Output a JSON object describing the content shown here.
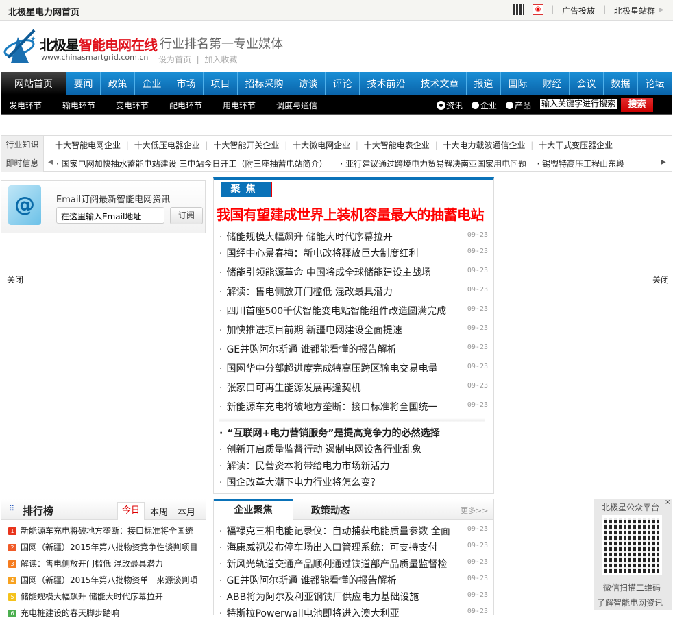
{
  "topbar": {
    "title": "北极星电力网首页",
    "ad": "广告投放",
    "sites": "北极星站群"
  },
  "logo": {
    "brand_black": "北极星",
    "brand_red": "智能电网在线",
    "url": "www.chinasmartgrid.com.cn",
    "slogan": "行业排名第一专业媒体",
    "set_home": "设为首页",
    "bookmark": "加入收藏"
  },
  "nav": {
    "main": [
      "网站首页",
      "要闻",
      "政策",
      "企业",
      "市场",
      "项目",
      "招标采购",
      "访谈",
      "评论",
      "技术前沿",
      "技术文章",
      "报道",
      "国际",
      "财经",
      "会议",
      "数据",
      "论坛"
    ],
    "sub": [
      "发电环节",
      "输电环节",
      "变电环节",
      "配电环节",
      "用电环节",
      "调度与通信"
    ]
  },
  "search": {
    "options": [
      "资讯",
      "企业",
      "产品"
    ],
    "selected": "资讯",
    "placeholder": "输入关键字进行搜索",
    "button": "搜索"
  },
  "knowledge": {
    "label": "行业知识",
    "links": [
      "十大智能电网企业",
      "十大低压电器企业",
      "十大智能开关企业",
      "十大微电网企业",
      "十大智能电表企业",
      "十大电力载波通信企业",
      "十大干式变压器企业"
    ]
  },
  "ticker": {
    "label": "即时信息",
    "items": [
      "国家电网加快抽水蓄能电站建设 三电站今日开工（附三座抽蓄电站简介）",
      "亚行建议通过跨境电力贸易解决南亚国家用电问题",
      "锡盟特高压工程山东段"
    ]
  },
  "email": {
    "title": "Email订阅最新智能电网资讯",
    "placeholder": "在这里输入Email地址",
    "button": "订阅"
  },
  "focus": {
    "tab": "聚焦",
    "headline": "我国有望建成世界上装机容量最大的抽蓄电站",
    "items": [
      {
        "t": "储能规模大幅飙升 储能大时代序幕拉开",
        "d": "09-23"
      },
      {
        "t": "国经中心景春梅：新电改将释放巨大制度红利",
        "d": "09-23"
      },
      {
        "t": "储能引领能源革命 中国将成全球储能建设主战场",
        "d": "09-23"
      },
      {
        "t": "解读：售电侧放开门槛低 混改最具潜力",
        "d": "09-23"
      },
      {
        "t": "四川首座500千伏智能变电站智能组件改造圆满完成",
        "d": "09-23"
      },
      {
        "t": "加快推进项目前期 新疆电网建设全面提速",
        "d": "09-23"
      },
      {
        "t": "GE并购阿尔斯通 谁都能看懂的报告解析",
        "d": "09-23"
      },
      {
        "t": "国网华中分部超进度完成特高压跨区输电交易电量",
        "d": "09-23"
      },
      {
        "t": "张家口可再生能源发展再逢契机",
        "d": "09-23"
      },
      {
        "t": "新能源车充电将破地方垄断：接口标准将全国统一",
        "d": "09-23"
      }
    ],
    "extra": [
      "“互联网+电力营销服务”是提高竞争力的必然选择",
      "创新开启质量监督行动 遏制电网设备行业乱象",
      "解读：民营资本将带给电力市场新活力",
      "国企改革大潮下电力行业将怎么变？"
    ]
  },
  "close_label": "关闭",
  "rank": {
    "title": "排行榜",
    "tabs": [
      "今日",
      "本周",
      "本月"
    ],
    "active": "今日",
    "items": [
      "新能源车充电将破地方垄断：接口标准将全国统",
      "国网（新疆）2015年第八批物资竞争性谈判项目",
      "解读：售电侧放开门槛低 混改最具潜力",
      "国网（新疆）2015年第八批物资单一来源谈判项",
      "储能规模大幅飙升 储能大时代序幕拉开",
      "充电桩建设的春天脚步踏响"
    ],
    "colors": [
      "#e8341c",
      "#f05a28",
      "#f57c1f",
      "#f7a11f",
      "#f5c21b",
      "#4caf50"
    ]
  },
  "enterprise": {
    "tabs": [
      "企业聚焦",
      "政策动态"
    ],
    "more": "更多>>",
    "items": [
      {
        "t": "福禄克三相电能记录仪：自动捕获电能质量参数 全面",
        "d": "09-23"
      },
      {
        "t": "海康威视发布停车场出入口管理系统：可支持支付",
        "d": "09-23"
      },
      {
        "t": "新风光轨道交通产品顺利通过铁道部产品质量监督检",
        "d": "09-23"
      },
      {
        "t": "GE并购阿尔斯通 谁都能看懂的报告解析",
        "d": "09-23"
      },
      {
        "t": "ABB将为阿尔及利亚钢铁厂供应电力基础设施",
        "d": "09-23"
      },
      {
        "t": "特斯拉Powerwall电池即将进入澳大利亚",
        "d": "09-23"
      }
    ]
  },
  "qr": {
    "title": "北极星公众平台",
    "line1": "微信扫描二维码",
    "line2": "了解智能电网资讯"
  }
}
